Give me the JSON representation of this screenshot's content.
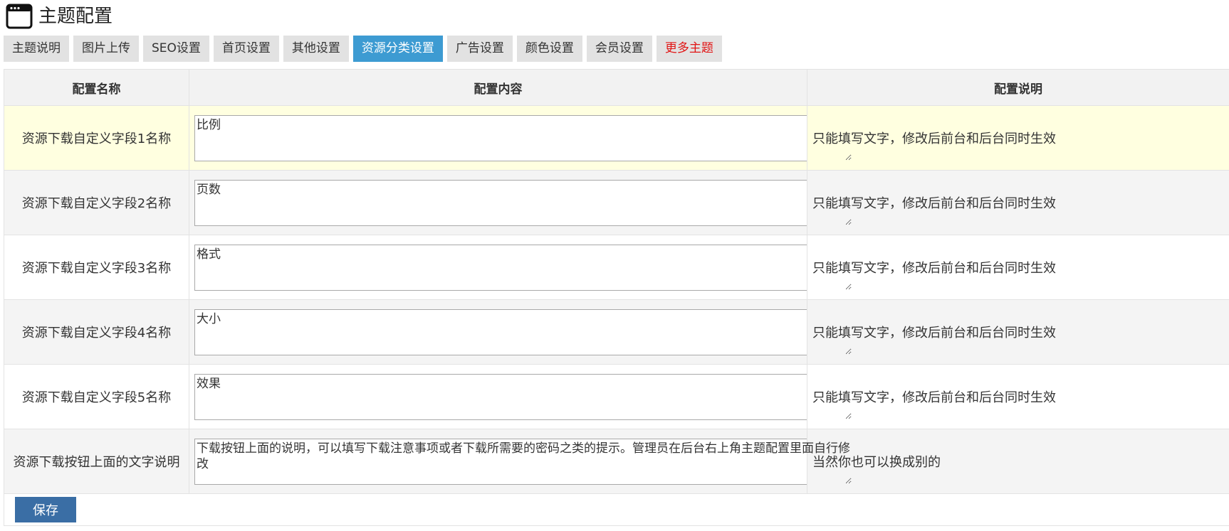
{
  "header": {
    "icon": "window-icon",
    "title": "主题配置"
  },
  "tabs": [
    {
      "label": "主题说明"
    },
    {
      "label": "图片上传"
    },
    {
      "label": "SEO设置"
    },
    {
      "label": "首页设置"
    },
    {
      "label": "其他设置"
    },
    {
      "label": "资源分类设置",
      "active": true
    },
    {
      "label": "广告设置"
    },
    {
      "label": "颜色设置"
    },
    {
      "label": "会员设置"
    },
    {
      "label": "更多主题",
      "color": "#e11515"
    }
  ],
  "table": {
    "headers": {
      "name": "配置名称",
      "content": "配置内容",
      "desc": "配置说明"
    },
    "rows": [
      {
        "name": "资源下载自定义字段1名称",
        "value": "比例",
        "desc": "只能填写文字，修改后前台和后台同时生效"
      },
      {
        "name": "资源下载自定义字段2名称",
        "value": "页数",
        "desc": "只能填写文字，修改后前台和后台同时生效"
      },
      {
        "name": "资源下载自定义字段3名称",
        "value": "格式",
        "desc": "只能填写文字，修改后前台和后台同时生效"
      },
      {
        "name": "资源下载自定义字段4名称",
        "value": "大小",
        "desc": "只能填写文字，修改后前台和后台同时生效"
      },
      {
        "name": "资源下载自定义字段5名称",
        "value": "效果",
        "desc": "只能填写文字，修改后前台和后台同时生效"
      },
      {
        "name": "资源下载按钮上面的文字说明",
        "value": "下载按钮上面的说明，可以填写下载注意事项或者下载所需要的密码之类的提示。管理员在后台右上角主题配置里面自行修改",
        "desc": "当然你也可以换成别的"
      }
    ]
  },
  "save_label": "保存",
  "colors": {
    "active_tab": "#3d9bd2",
    "more_tab_text": "#e11515",
    "save_button": "#3a6ea5",
    "highlight_row": "#ffffe0"
  }
}
